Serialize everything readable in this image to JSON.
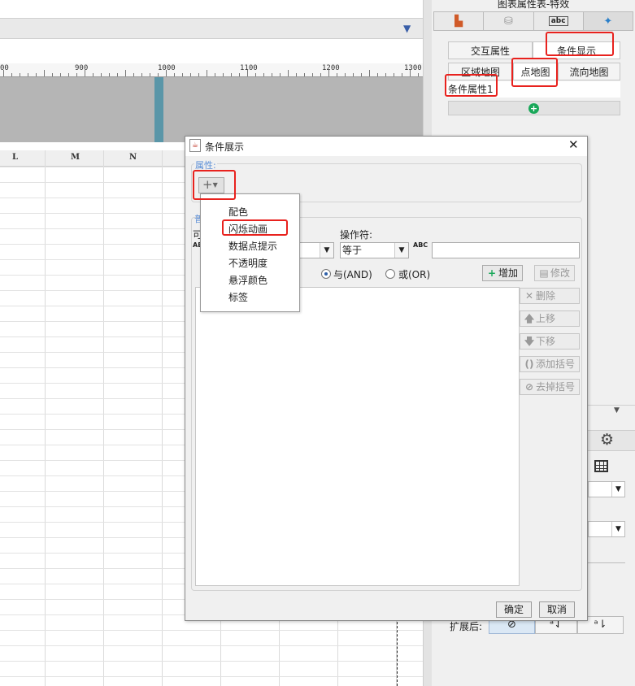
{
  "designer": {
    "ruler": [
      "00",
      "900",
      "1000",
      "1100",
      "1200",
      "1300"
    ],
    "columns": [
      "L",
      "M",
      "N"
    ]
  },
  "prop_panel": {
    "title": "图表属性表-特效",
    "tab_icons": [
      "chart-type-icon",
      "data-icon",
      "style-icon",
      "effects-icon"
    ],
    "subtabs": [
      "交互属性",
      "条件显示"
    ],
    "map_tabs": [
      "区域地图",
      "点地图",
      "流向地图"
    ],
    "condition_item": "条件属性1",
    "add_button_symbol": "+",
    "expand_label": "扩展后:",
    "expand_buttons": [
      "⊘",
      "ᵃ⇃",
      "ᵃ⇂"
    ]
  },
  "dialog": {
    "title": "条件展示",
    "property_group_label": "属性:",
    "plus_symbol": "+",
    "condition_group_label": "普",
    "col_label": "可",
    "operator_label": "操作符:",
    "operator_value": "等于",
    "and_label": "与(AND)",
    "or_label": "或(OR)",
    "add_label": "增加",
    "modify_label": "修改",
    "delete_label": "删除",
    "move_up_label": "上移",
    "move_down_label": "下移",
    "add_bracket_label": "添加括号",
    "remove_bracket_label": "去掉括号",
    "ok_label": "确定",
    "cancel_label": "取消"
  },
  "popup_menu": {
    "items": [
      "配色",
      "闪烁动画",
      "数据点提示",
      "不透明度",
      "悬浮颜色",
      "标签"
    ],
    "highlighted": "闪烁动画"
  },
  "colors": {
    "highlight_red": "#e8221e",
    "add_green": "#1aa85a",
    "group_label_blue": "#5b8ed6"
  }
}
